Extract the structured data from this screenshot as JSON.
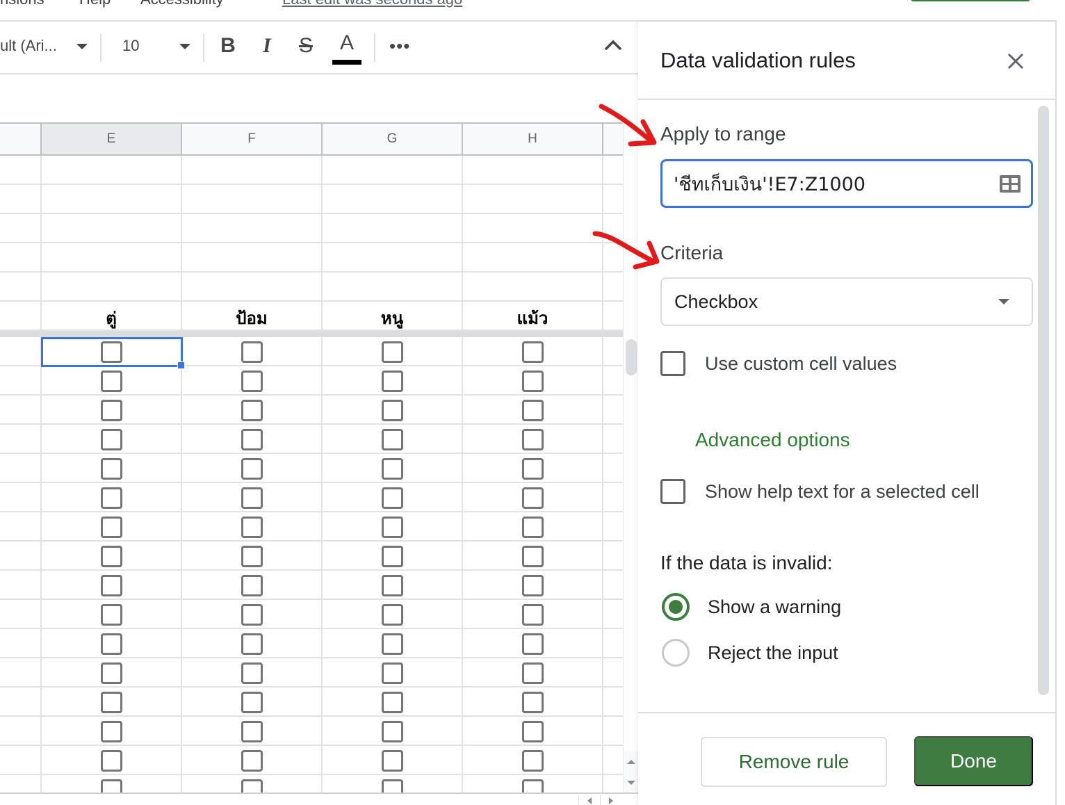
{
  "menu": {
    "items": [
      "nsions",
      "Help",
      "Accessibility"
    ],
    "last_edit": "Last edit was seconds ago"
  },
  "toolbar": {
    "font_name": "ult (Ari...",
    "font_size": "10",
    "bold_icon": "B",
    "italic_icon": "I",
    "strike_icon": "S",
    "text_color_icon": "A",
    "text_color": "#000000",
    "more_icon": "•••"
  },
  "sheet": {
    "columns": [
      "E",
      "F",
      "G",
      "H"
    ],
    "selected_column": "E",
    "names": [
      "ตู่",
      "ป้อม",
      "หนู",
      "แม้ว"
    ],
    "checkbox_rows": 16,
    "checkbox_state": "unchecked"
  },
  "panel": {
    "title": "Data validation rules",
    "apply_to_range_label": "Apply to range",
    "range_value": "'ชีทเก็บเงิน'!E7:Z1000",
    "criteria_label": "Criteria",
    "criteria_value": "Checkbox",
    "use_custom_values_label": "Use custom cell values",
    "use_custom_values_checked": false,
    "advanced_options_label": "Advanced options",
    "show_help_text_label": "Show help text for a selected cell",
    "show_help_text_checked": false,
    "invalid_label": "If the data is invalid:",
    "invalid_options": [
      {
        "label": "Show a warning",
        "selected": true
      },
      {
        "label": "Reject the input",
        "selected": false
      }
    ],
    "remove_button": "Remove rule",
    "done_button": "Done"
  },
  "colors": {
    "accent_blue": "#3b73d9",
    "accent_green": "#3f7c42",
    "annotation_red": "#e01b1b"
  }
}
